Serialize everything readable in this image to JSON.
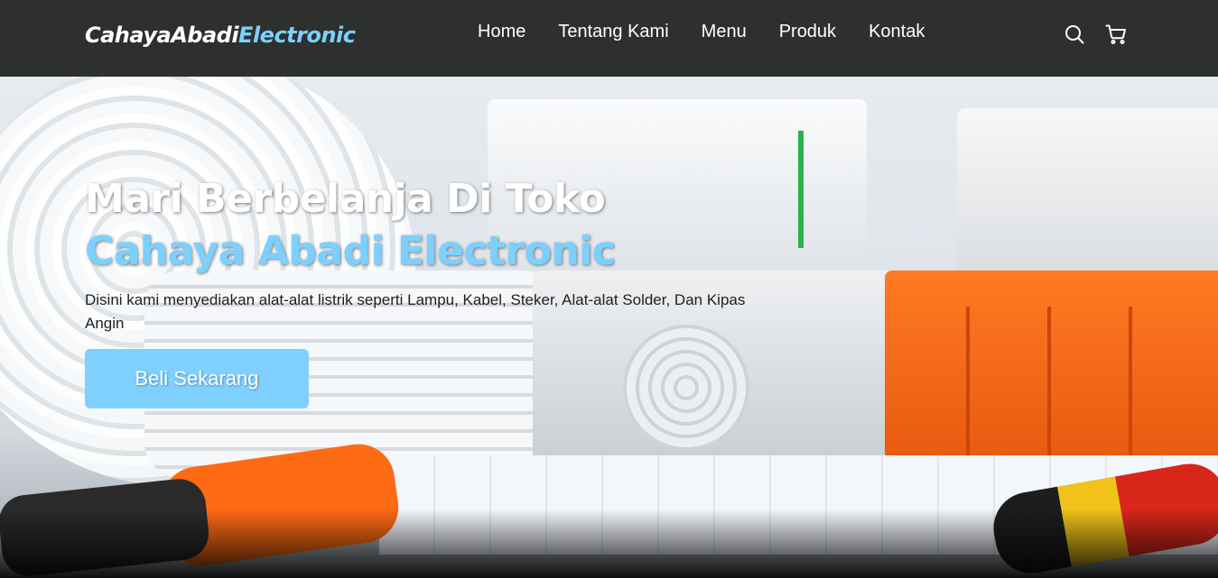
{
  "brand": {
    "name_part1": "CahayaAbadi",
    "name_part2": "Electronic"
  },
  "nav": {
    "items": [
      {
        "label": "Home"
      },
      {
        "label": "Tentang Kami"
      },
      {
        "label": "Menu"
      },
      {
        "label": "Produk"
      },
      {
        "label": "Kontak"
      }
    ],
    "icons": [
      "search-icon",
      "cart-icon"
    ]
  },
  "hero": {
    "title_line1": "Mari Berbelanja Di Toko",
    "title_line2": "Cahaya Abadi Electronic",
    "description": "Disini kami menyediakan alat-alat listrik seperti Lampu, Kabel, Steker, Alat-alat Solder, Dan Kipas Angin",
    "cta_label": "Beli Sekarang"
  },
  "colors": {
    "navbar_bg": "#2e302f",
    "accent": "#7bd0ff",
    "button_bg": "#7fd0ff",
    "text_light": "#ffffff"
  }
}
